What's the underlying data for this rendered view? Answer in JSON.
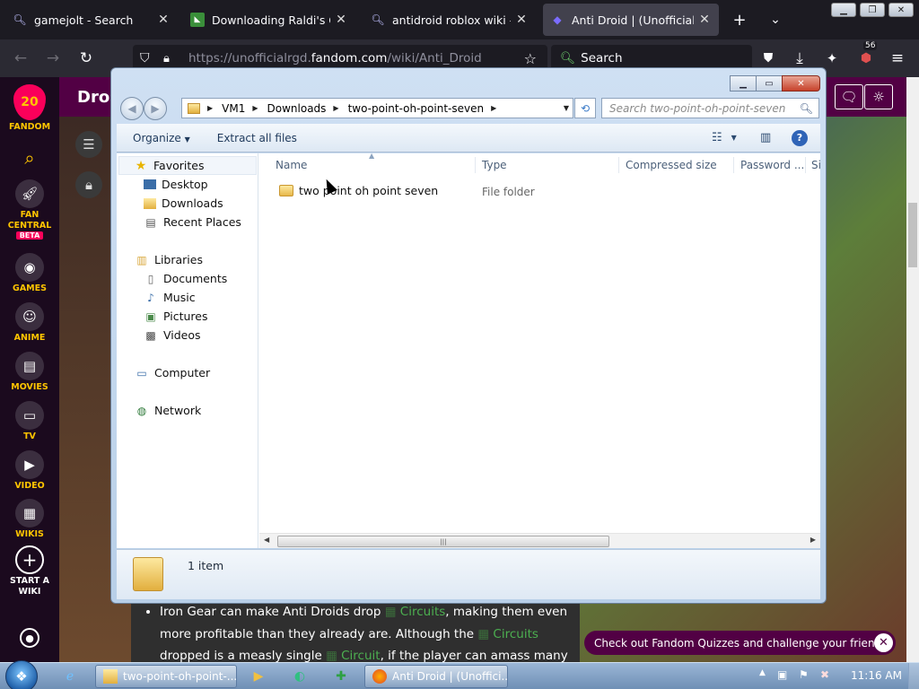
{
  "browser": {
    "tabs": [
      {
        "title": "gamejolt - Search",
        "icon": "search-icon"
      },
      {
        "title": "Downloading Raldi's Crack",
        "icon": "favicon-green"
      },
      {
        "title": "antidroid roblox wiki - Sear",
        "icon": "search-icon"
      },
      {
        "title": "Anti Droid | (Unofficial) Ra",
        "icon": "fandom-favicon"
      }
    ],
    "url_prefix": "https://unofficialrgd.",
    "url_domain": "fandom.com",
    "url_path": "/wiki/Anti_Droid",
    "search_placeholder": "Search",
    "extensions_badge": "56"
  },
  "fandom": {
    "logo_number": "20",
    "rail": [
      {
        "label": "FANDOM",
        "icon": "fandom-logo"
      },
      {
        "label": "",
        "icon": "search-icon"
      },
      {
        "label": "FAN CENTRAL",
        "icon": "rocket-icon"
      },
      {
        "label": "BETA",
        "icon": ""
      },
      {
        "label": "GAMES",
        "icon": "gamepad-icon"
      },
      {
        "label": "ANIME",
        "icon": "anime-icon"
      },
      {
        "label": "MOVIES",
        "icon": "clapperboard-icon"
      },
      {
        "label": "TV",
        "icon": "tv-icon"
      },
      {
        "label": "VIDEO",
        "icon": "play-icon"
      },
      {
        "label": "WIKIS",
        "icon": "book-icon"
      },
      {
        "label": "START A WIKI",
        "icon": "plus-icon"
      }
    ],
    "header_title": "Droi",
    "article": {
      "line1_a": "Iron Gear can make Anti Droids drop ",
      "line1_link": "Circuits",
      "line1_b": ", making them even",
      "line2_a": "more profitable than they already are. Although the ",
      "line2_link": "Circuits",
      "line3_a": "dropped is a measly single ",
      "line3_link": "Circuit",
      "line3_b": ", if the player can amass many"
    },
    "quiz_banner": "Check out Fandom Quizzes and challenge your friends!"
  },
  "explorer": {
    "address": [
      "VM1",
      "Downloads",
      "two-point-oh-point-seven"
    ],
    "search_placeholder": "Search two-point-oh-point-seven",
    "commands": {
      "organize": "Organize",
      "extract": "Extract all files"
    },
    "nav": {
      "favorites": "Favorites",
      "desktop": "Desktop",
      "downloads": "Downloads",
      "recent": "Recent Places",
      "libraries": "Libraries",
      "documents": "Documents",
      "music": "Music",
      "pictures": "Pictures",
      "videos": "Videos",
      "computer": "Computer",
      "network": "Network"
    },
    "columns": [
      "Name",
      "Type",
      "Compressed size",
      "Password ...",
      "Si"
    ],
    "rows": [
      {
        "name": "two point oh point seven",
        "type": "File folder"
      }
    ],
    "status": "1 item"
  },
  "taskbar": {
    "buttons": [
      {
        "label": "two-point-oh-point-...",
        "icon": "folder-icon"
      },
      {
        "label": "Anti Droid | (Unoffici...",
        "icon": "firefox-icon"
      }
    ],
    "clock": "11:16 AM"
  },
  "colors": {
    "fandom_purple": "#520044",
    "fandom_yellow": "#ffc500",
    "link_green": "#4caf50",
    "firefox_dark": "#1c1b22"
  }
}
